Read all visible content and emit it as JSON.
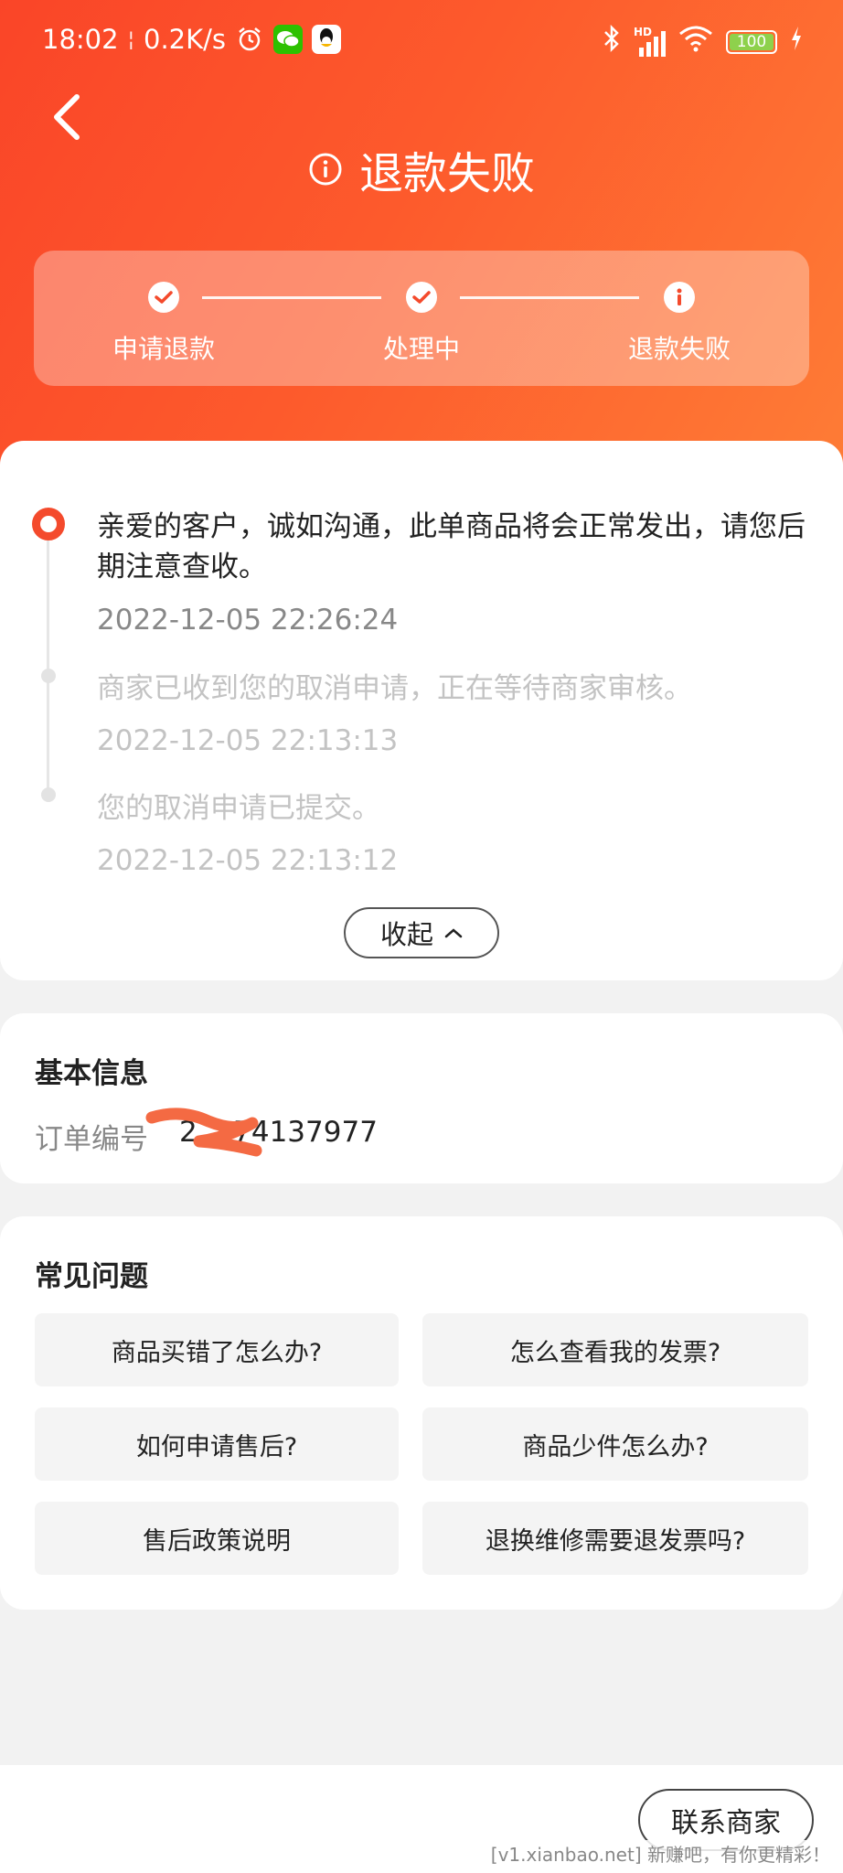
{
  "status_bar": {
    "time": "18:02",
    "net_speed": "0.2K/s",
    "signal": "HD",
    "battery": "100"
  },
  "header": {
    "title": "退款失败",
    "steps": [
      {
        "label": "申请退款",
        "state": "done"
      },
      {
        "label": "处理中",
        "state": "done"
      },
      {
        "label": "退款失败",
        "state": "failed"
      }
    ]
  },
  "timeline": {
    "entries": [
      {
        "text": "亲爱的客户，诚如沟通，此单商品将会正常发出，请您后期注意查收。",
        "time": "2022-12-05 22:26:24",
        "active": true
      },
      {
        "text": "商家已收到您的取消申请，正在等待商家审核。",
        "time": "2022-12-05 22:13:13",
        "active": false
      },
      {
        "text": "您的取消申请已提交。",
        "time": "2022-12-05 22:13:12",
        "active": false
      }
    ],
    "collapse_label": "收起"
  },
  "basic_info": {
    "title": "基本信息",
    "order_label": "订单编号",
    "order_value": "2    74137977"
  },
  "faq": {
    "title": "常见问题",
    "items": [
      "商品买错了怎么办?",
      "怎么查看我的发票?",
      "如何申请售后?",
      "商品少件怎么办?",
      "售后政策说明",
      "退换维修需要退发票吗?"
    ]
  },
  "footer": {
    "contact_label": "联系商家",
    "watermark": "[v1.xianbao.net] 新赚吧，有你更精彩！"
  },
  "colors": {
    "accent": "#f44a2c",
    "gradient_start": "#fa4528",
    "gradient_end": "#fe7d36"
  }
}
